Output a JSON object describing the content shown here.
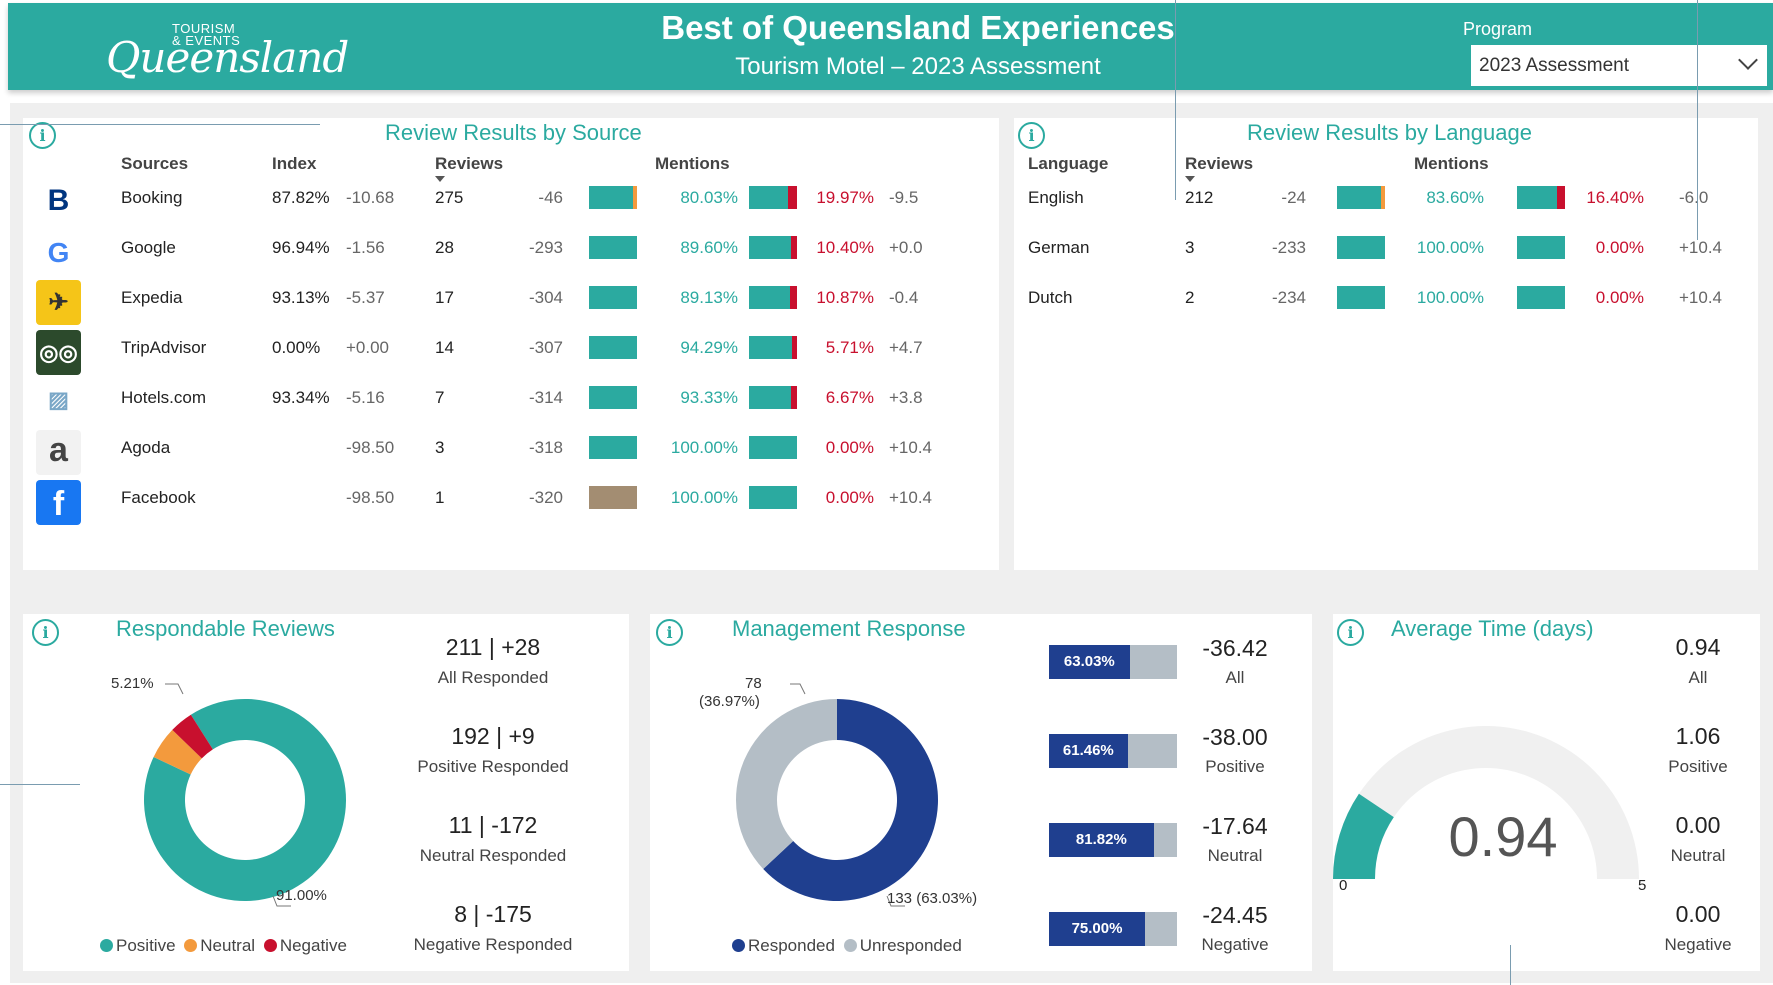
{
  "header": {
    "logo_small": "TOURISM\n& EVENTS",
    "logo_script": "Queensland",
    "title": "Best of Queensland Experiences",
    "subtitle": "Tourism Motel – 2023 Assessment",
    "program_label": "Program",
    "program_value": "2023 Assessment"
  },
  "colors": {
    "teal": "#2baaa0",
    "orange": "#f39a3d",
    "red": "#c8102e",
    "navy": "#1f3f8f",
    "lightgray": "#b4bec6",
    "tan": "#a38d72"
  },
  "source_panel": {
    "title": "Review Results by Source",
    "columns": {
      "sources": "Sources",
      "index": "Index",
      "reviews": "Reviews",
      "mentions": "Mentions"
    },
    "rows": [
      {
        "icon": "booking-icon",
        "name": "Booking",
        "index": "87.82%",
        "index_delta": "-10.68",
        "reviews": "275",
        "reviews_delta": "-46",
        "pos": "80.03%",
        "neg": "19.97%",
        "mention_delta": "-9.5",
        "pos_frac": 0.8,
        "neu_frac": 0.03,
        "bar_color": "#2baaa0"
      },
      {
        "icon": "google-icon",
        "name": "Google",
        "index": "96.94%",
        "index_delta": "-1.56",
        "reviews": "28",
        "reviews_delta": "-293",
        "pos": "89.60%",
        "neg": "10.40%",
        "mention_delta": "+0.0",
        "pos_frac": 0.96,
        "neu_frac": 0.0,
        "bar_color": "#2baaa0"
      },
      {
        "icon": "expedia-icon",
        "name": "Expedia",
        "index": "93.13%",
        "index_delta": "-5.37",
        "reviews": "17",
        "reviews_delta": "-304",
        "pos": "89.13%",
        "neg": "10.87%",
        "mention_delta": "-0.4",
        "pos_frac": 1.0,
        "neu_frac": 0.0,
        "bar_color": "#2baaa0"
      },
      {
        "icon": "tripadvisor-icon",
        "name": "TripAdvisor",
        "index": "0.00%",
        "index_delta": "+0.00",
        "reviews": "14",
        "reviews_delta": "-307",
        "pos": "94.29%",
        "neg": "5.71%",
        "mention_delta": "+4.7",
        "pos_frac": 1.0,
        "neu_frac": 0.0,
        "bar_color": "#2baaa0"
      },
      {
        "icon": "hotels-com-icon",
        "name": "Hotels.com",
        "index": "93.34%",
        "index_delta": "-5.16",
        "reviews": "7",
        "reviews_delta": "-314",
        "pos": "93.33%",
        "neg": "6.67%",
        "mention_delta": "+3.8",
        "pos_frac": 1.0,
        "neu_frac": 0.0,
        "bar_color": "#2baaa0"
      },
      {
        "icon": "agoda-icon",
        "name": "Agoda",
        "index": "",
        "index_delta": "-98.50",
        "reviews": "3",
        "reviews_delta": "-318",
        "pos": "100.00%",
        "neg": "0.00%",
        "mention_delta": "+10.4",
        "pos_frac": 1.0,
        "neu_frac": 0.0,
        "bar_color": "#2baaa0"
      },
      {
        "icon": "facebook-icon",
        "name": "Facebook",
        "index": "",
        "index_delta": "-98.50",
        "reviews": "1",
        "reviews_delta": "-320",
        "pos": "100.00%",
        "neg": "0.00%",
        "mention_delta": "+10.4",
        "pos_frac": 1.0,
        "neu_frac": 0.0,
        "bar_color": "#a38d72"
      }
    ]
  },
  "language_panel": {
    "title": "Review Results by Language",
    "columns": {
      "language": "Language",
      "reviews": "Reviews",
      "mentions": "Mentions"
    },
    "rows": [
      {
        "name": "English",
        "reviews": "212",
        "reviews_delta": "-24",
        "pos": "83.60%",
        "neg": "16.40%",
        "mention_delta": "-6.0",
        "pos_frac": 0.9,
        "neu_frac": 0.03
      },
      {
        "name": "German",
        "reviews": "3",
        "reviews_delta": "-233",
        "pos": "100.00%",
        "neg": "0.00%",
        "mention_delta": "+10.4",
        "pos_frac": 1.0,
        "neu_frac": 0.0
      },
      {
        "name": "Dutch",
        "reviews": "2",
        "reviews_delta": "-234",
        "pos": "100.00%",
        "neg": "0.00%",
        "mention_delta": "+10.4",
        "pos_frac": 1.0,
        "neu_frac": 0.0
      }
    ]
  },
  "respondable": {
    "title": "Respondable Reviews",
    "label_small": "5.21%",
    "label_large": "91.00%",
    "legend": [
      "Positive",
      "Neutral",
      "Negative"
    ],
    "stats": [
      {
        "value": "211",
        "delta": "+28",
        "label": "All Responded"
      },
      {
        "value": "192",
        "delta": "+9",
        "label": "Positive Responded"
      },
      {
        "value": "11",
        "delta": "-172",
        "label": "Neutral Responded"
      },
      {
        "value": "8",
        "delta": "-175",
        "label": "Negative Responded"
      }
    ]
  },
  "management": {
    "title": "Management Response",
    "label_unresp_count": "78",
    "label_unresp_pct": "(36.97%)",
    "label_resp": "133 (63.03%)",
    "legend": [
      "Responded",
      "Unresponded"
    ],
    "bars": [
      {
        "pct": "63.03%",
        "frac": 0.6303,
        "delta": "-36.42",
        "label": "All"
      },
      {
        "pct": "61.46%",
        "frac": 0.6146,
        "delta": "-38.00",
        "label": "Positive"
      },
      {
        "pct": "81.82%",
        "frac": 0.8182,
        "delta": "-17.64",
        "label": "Neutral"
      },
      {
        "pct": "75.00%",
        "frac": 0.75,
        "delta": "-24.45",
        "label": "Negative"
      }
    ]
  },
  "avg_time": {
    "title": "Average Time (days)",
    "gauge_value": "0.94",
    "gauge_min": "0",
    "gauge_max": "5",
    "stats": [
      {
        "value": "0.94",
        "label": "All"
      },
      {
        "value": "1.06",
        "label": "Positive"
      },
      {
        "value": "0.00",
        "label": "Neutral"
      },
      {
        "value": "0.00",
        "label": "Negative"
      }
    ]
  },
  "chart_data": [
    {
      "type": "pie",
      "categories": [
        "Positive",
        "Neutral",
        "Negative"
      ],
      "values": [
        91.0,
        5.21,
        3.79
      ]
    },
    {
      "type": "pie",
      "categories": [
        "Responded",
        "Unresponded"
      ],
      "values": [
        133,
        78
      ]
    },
    {
      "type": "bar",
      "categories": [
        "All",
        "Positive",
        "Neutral",
        "Negative"
      ],
      "values": [
        63.03,
        61.46,
        81.82,
        75.0
      ],
      "ylim": [
        0,
        100
      ]
    },
    {
      "type": "gauge",
      "value": 0.94,
      "ylim": [
        0,
        5
      ]
    }
  ]
}
